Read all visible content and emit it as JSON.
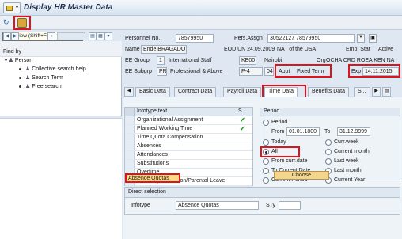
{
  "title": "Display HR Master Data",
  "tooltip": "Overview   (Shift+F8)",
  "left_panel": {
    "find_by": "Find by",
    "tree_root": "Person",
    "items": [
      "Collective search help",
      "Search Term",
      "Free search"
    ]
  },
  "header": {
    "personnel_no_label": "Personnel No.",
    "personnel_no": "78579950",
    "pers_assgn_label": "Pers.Assgn",
    "pers_assgn": "30522127 78579950",
    "name_label": "Name",
    "name": "Ende BRAGADO",
    "eod_un": "EOD UN 24.09.2009",
    "nat": "NAT of the USA",
    "emp_stat_label": "Emp. Stat",
    "emp_stat": "Active",
    "ee_group_label": "EE Group",
    "ee_group_code": "1",
    "ee_group": "International Staff",
    "ke_code": "KE00",
    "location": "Nairobi",
    "org_label": "Org",
    "org": "OCHA CRD ROEA KEN NA",
    "ee_subgrp_label": "EE Subgrp",
    "ee_subgrp_code": "PR",
    "ee_subgrp": "Professional & Above",
    "grade": "P-4",
    "grade_step": "04",
    "appt_label": "Appt",
    "appt": "Fixed Term",
    "exp_label": "Exp",
    "exp": "14.11.2015"
  },
  "tabs": [
    "Basic Data",
    "Contract Data",
    "Payroll Data",
    "Time Data",
    "Benefits Data",
    "S..."
  ],
  "active_tab": "Time Data",
  "infotype_table": {
    "col_text": "Infotype text",
    "col_s": "S...",
    "rows": [
      {
        "text": "Organizational Assignment",
        "check": "✔"
      },
      {
        "text": "Planned Working Time",
        "check": "✔"
      },
      {
        "text": "Time Quota Compensation",
        "check": ""
      },
      {
        "text": "Absences",
        "check": ""
      },
      {
        "text": "Attendances",
        "check": ""
      },
      {
        "text": "Substitutions",
        "check": ""
      },
      {
        "text": "Overtime",
        "check": ""
      },
      {
        "text": "Maternity Protection/Parental Leave",
        "check": ""
      },
      {
        "text": "Absence Quotas",
        "check": ""
      }
    ]
  },
  "period": {
    "title": "Period",
    "period_label": "Period",
    "from_label": "From",
    "from": "01.01.1800",
    "to_label": "To",
    "to": "31.12.9999",
    "options_left": [
      "Today",
      "All",
      "From curr.date",
      "To Current Date",
      "Current Period"
    ],
    "options_right": [
      "Curr.week",
      "Current month",
      "Last week",
      "Last month",
      "Current Year"
    ],
    "selected": "All",
    "choose": "Choose"
  },
  "direct_selection": {
    "title": "Direct selection",
    "infotype_label": "Infotype",
    "infotype": "Absence Quotas",
    "sty_label": "STy"
  }
}
